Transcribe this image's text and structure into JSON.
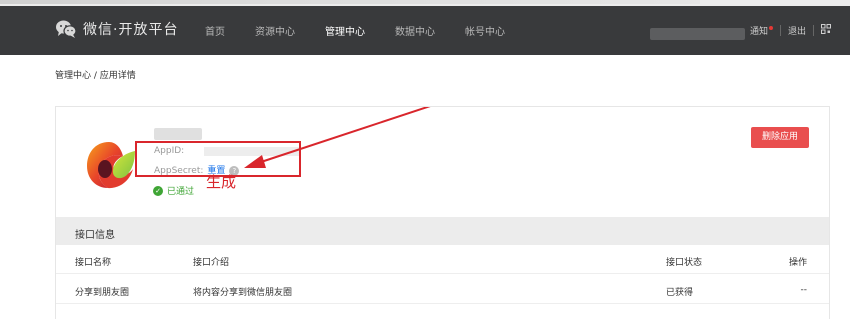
{
  "navbar": {
    "logo_text": "微信·开放平台",
    "items": [
      {
        "label": "首页",
        "active": false
      },
      {
        "label": "资源中心",
        "active": false
      },
      {
        "label": "管理中心",
        "active": true
      },
      {
        "label": "数据中心",
        "active": false
      },
      {
        "label": "帐号中心",
        "active": false
      }
    ],
    "notice_label": "通知",
    "logout_label": "退出",
    "qr_icon": "qr-code-icon"
  },
  "breadcrumb": "管理中心 / 应用详情",
  "app": {
    "appid_label": "AppID:",
    "appsecret_label": "AppSecret:",
    "reset_label": "重置",
    "help_glyph": "?",
    "status_label": "已通过",
    "delete_label": "删除应用"
  },
  "annotation": {
    "text": "生成",
    "color": "#d9262c"
  },
  "interface_section": {
    "title": "接口信息",
    "columns": [
      "接口名称",
      "接口介绍",
      "接口状态",
      "操作"
    ],
    "rows": [
      [
        "分享到朋友圈",
        "将内容分享到微信朋友圈",
        "已获得",
        "--"
      ]
    ]
  },
  "colors": {
    "navbar_bg": "#393a3c",
    "delete_button": "#e94e4e",
    "status_green": "#3fa535",
    "link_blue": "#1a73e8"
  }
}
